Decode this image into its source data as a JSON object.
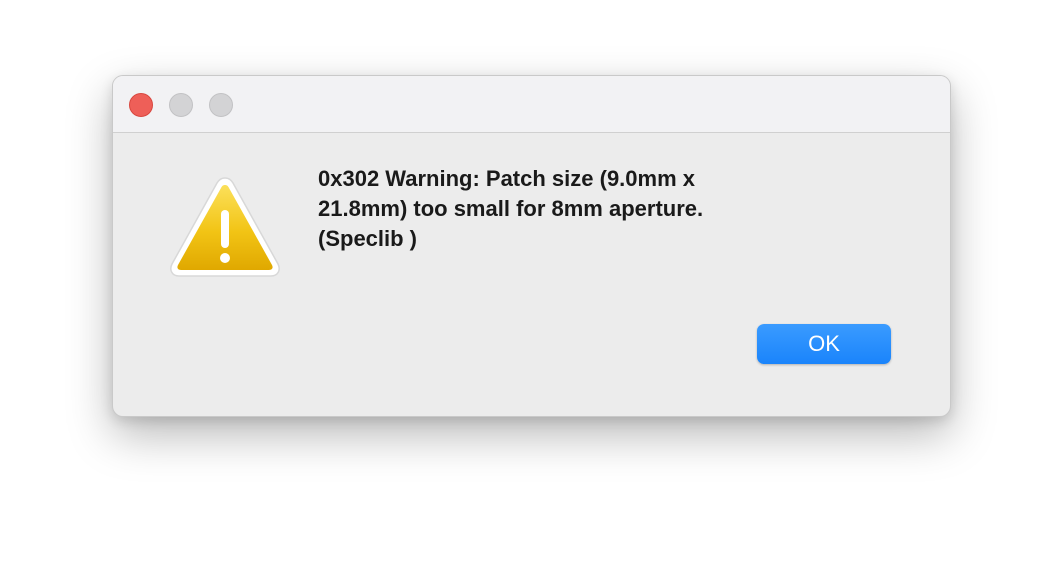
{
  "dialog": {
    "message": "0x302 Warning: Patch size (9.0mm x\n21.8mm) too small for 8mm aperture.\n (Speclib )",
    "ok_label": "OK",
    "icon": "warning-triangle-icon"
  },
  "colors": {
    "close_button": "#ee5f58",
    "inactive_button": "#d3d3d5",
    "ok_button": "#1a84fb",
    "warning_yellow": "#f2c415",
    "dialog_background": "#ececec"
  }
}
